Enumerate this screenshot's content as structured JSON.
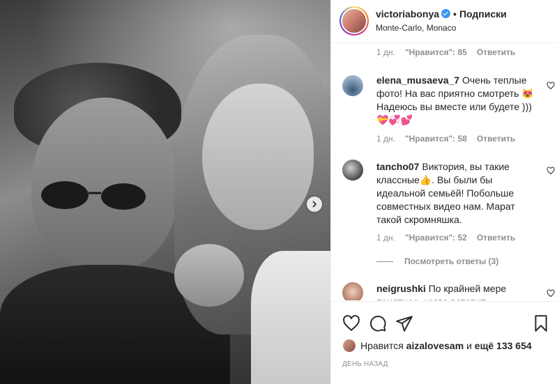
{
  "header": {
    "username": "victoriabonya",
    "separator": "•",
    "follow_label": "Подписки",
    "location": "Monte-Carlo, Monaco"
  },
  "comments": [
    {
      "meta": {
        "age": "1 дн.",
        "likes": "\"Нравится\": 85",
        "reply": "Ответить"
      }
    },
    {
      "username": "elena_musaeva_7",
      "text": "Очень теплые фото! На вас приятно смотреть 😻Надеюсь вы вместе или будете )))💝💞💕",
      "meta": {
        "age": "1 дн.",
        "likes": "\"Нравится\": 58",
        "reply": "Ответить"
      }
    },
    {
      "username": "tancho07",
      "text": "Виктория, вы такие классные👍. Вы были бы идеальной семьёй! Побольше совместных видео нам. Марат такой скромняшка.",
      "meta": {
        "age": "1 дн.",
        "likes": "\"Нравится\": 52",
        "reply": "Ответить"
      },
      "view_replies": "Посмотреть ответы (3)"
    },
    {
      "username": "neigrushki",
      "text": "По крайней мере приятное, когда вставит"
    }
  ],
  "footer": {
    "liked_by_prefix": "Нравится",
    "liked_by_user": "aizalovesam",
    "liked_by_middle": "и",
    "liked_by_count": "ещё 133 654",
    "date": "ДЕНЬ НАЗАД"
  },
  "icons": {
    "like": "heart-icon",
    "comment": "comment-icon",
    "share": "share-icon",
    "save": "bookmark-icon",
    "next": "chevron-right-icon"
  },
  "colors": {
    "verified": "#3897f0",
    "muted": "#8e8e8e",
    "text": "#262626"
  }
}
